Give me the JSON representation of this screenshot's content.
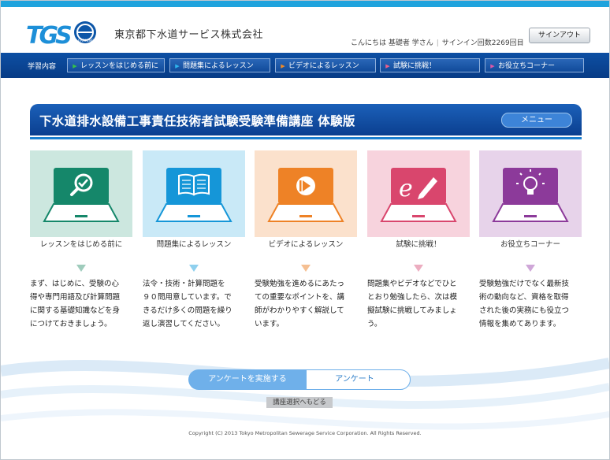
{
  "header": {
    "logo_text": "TGS",
    "logo_badge": "LEARNING",
    "company": "東京都下水道サービス株式会社",
    "greeting": "こんにちは 基礎者 学さん",
    "signin_count": "サインイン回数2269回目",
    "signout_label": "サインアウト"
  },
  "nav": {
    "label": "学習内容",
    "items": [
      {
        "label": "レッスンをはじめる前に",
        "arrow_color": "#35c24a"
      },
      {
        "label": "問題集によるレッスン",
        "arrow_color": "#2fb5ee"
      },
      {
        "label": "ビデオによるレッスン",
        "arrow_color": "#f08a26"
      },
      {
        "label": "試験に挑戦！",
        "arrow_color": "#ee5f8a"
      },
      {
        "label": "お役立ちコーナー",
        "arrow_color": "#d957a8"
      }
    ]
  },
  "title": {
    "text": "下水道排水設備工事責任技術者試験受験準備講座 体験版",
    "menu_label": "メニュー"
  },
  "cards": [
    {
      "label": "レッスンをはじめる前に",
      "icon": "magnifier-check-icon",
      "bg": "#cce7df",
      "accent": "#15876a",
      "tri": "#9fccbc",
      "desc": [
        "まず、はじめに、受験の心",
        "得や専門用語及び計算問題",
        "に関する基礎知識などを身",
        "につけておきましょう。"
      ]
    },
    {
      "label": "問題集によるレッスン",
      "icon": "book-icon",
      "bg": "#c9e9f7",
      "accent": "#1596d8",
      "tri": "#8fd0ee",
      "desc": [
        "法令・技術・計算問題を",
        "９０問用意しています。で",
        "きるだけ多くの問題を繰り",
        "返し演習してください。"
      ]
    },
    {
      "label": "ビデオによるレッスン",
      "icon": "play-icon",
      "bg": "#fbe1cc",
      "accent": "#ee8226",
      "tri": "#f5bf92",
      "desc": [
        "受験勉強を進めるにあたっ",
        "ての重要なポイントを、講",
        "師がわかりやすく解説して",
        "います。"
      ]
    },
    {
      "label": "試験に挑戦！",
      "icon": "exam-pencil-icon",
      "bg": "#f7d3dd",
      "accent": "#d9466d",
      "tri": "#ecadc0",
      "desc": [
        "問題集やビデオなどでひと",
        "とおり勉強したら、次は模",
        "擬試験に挑戦してみましょ",
        "う。"
      ]
    },
    {
      "label": "お役立ちコーナー",
      "icon": "lightbulb-icon",
      "bg": "#e7d3ea",
      "accent": "#8c3a9a",
      "tri": "#cfa7d8",
      "desc": [
        "受験勉強だけでなく最新技",
        "術の動向など、資格を取得",
        "された後の実務にも役立つ",
        "情報を集めてあります。"
      ]
    }
  ],
  "survey": {
    "left_label": "アンケートを実施する",
    "right_label": "アンケート"
  },
  "back_label": "講座選択へもどる",
  "copyright": "Copyright (C) 2013 Tokyo Metropolitan Sewerage Service Corporation. All Rights Reserved."
}
